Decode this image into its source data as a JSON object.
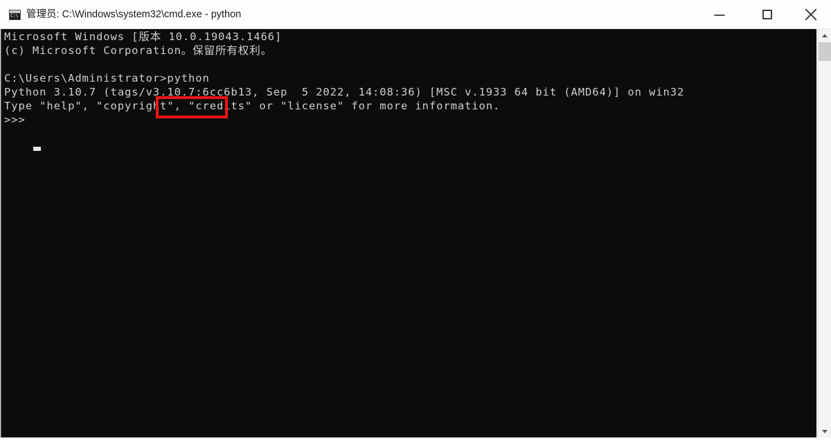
{
  "window": {
    "title": "管理员: C:\\Windows\\system32\\cmd.exe - python",
    "icon_name": "cmd-console-icon",
    "icon_label": "C:\\",
    "controls": {
      "minimize_label": "最小化",
      "maximize_label": "最大化",
      "close_label": "关闭"
    }
  },
  "console": {
    "lines": [
      "Microsoft Windows [版本 10.0.19043.1466]",
      "(c) Microsoft Corporation。保留所有权利。",
      "",
      "C:\\Users\\Administrator>python",
      "Python 3.10.7 (tags/v3.10.7:6cc6b13, Sep  5 2022, 14:08:36) [MSC v.1933 64 bit (AMD64)] on win32",
      "Type \"help\", \"copyright\", \"credits\" or \"license\" for more information.",
      ">>>"
    ],
    "text": "Microsoft Windows [版本 10.0.19043.1466]\n(c) Microsoft Corporation。保留所有权利。\n\nC:\\Users\\Administrator>python\nPython 3.10.7 (tags/v3.10.7:6cc6b13, Sep  5 2022, 14:08:36) [MSC v.1933 64 bit (AMD64)] on win32\nType \"help\", \"copyright\", \"credits\" or \"license\" for more information.\n>>>",
    "prompt": ">>>",
    "command_entered": "python",
    "background_color": "#0c0c0c",
    "text_color": "#cfcfcf"
  },
  "annotation": {
    "type": "rectangle-highlight",
    "target_text": ">python",
    "color": "#ef1414"
  },
  "scrollbar": {
    "up_arrow": "▲",
    "down_arrow": "▼",
    "thumb_label": "scroll-thumb"
  }
}
